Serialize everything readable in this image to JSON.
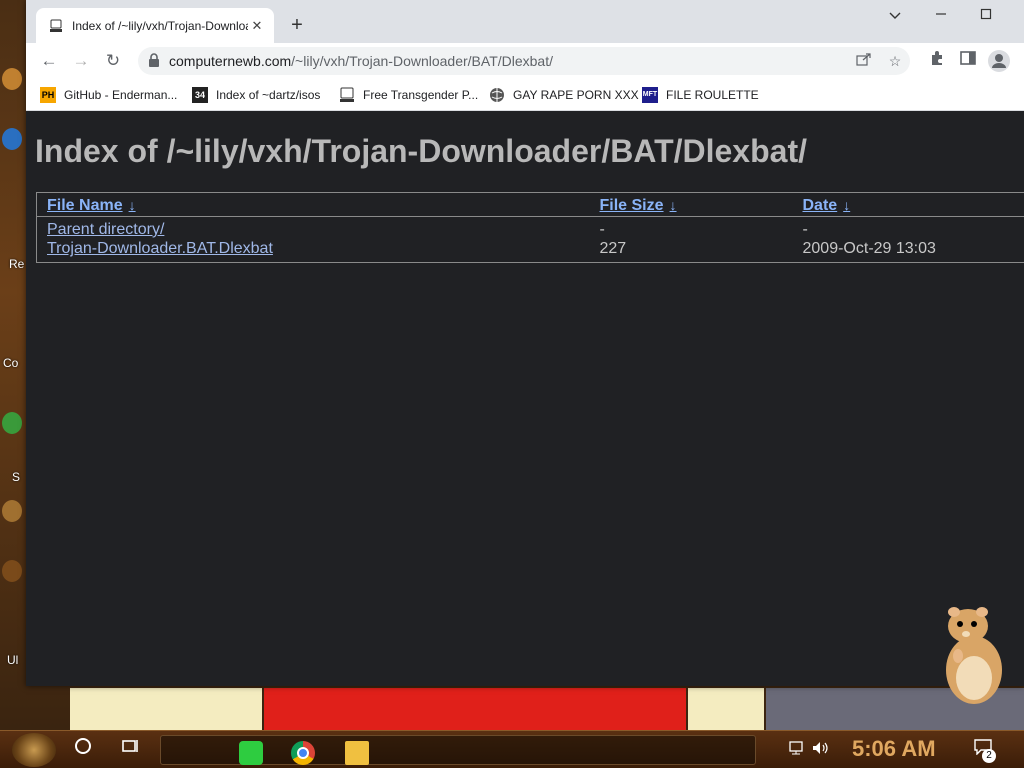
{
  "desktop": {
    "labels": [
      "Re",
      "Co",
      "S",
      "Ul"
    ]
  },
  "browser": {
    "tab": {
      "title": "Index of /~lily/vxh/Trojan-Downloader/BAT/Dlexbat/",
      "close": "✕"
    },
    "new_tab": "+",
    "window_controls": {
      "minimize": "⌄",
      "restore": "—",
      "maximize": "☐"
    },
    "nav": {
      "back": "←",
      "forward": "→",
      "reload": "↻"
    },
    "url": {
      "host": "computernewb.com",
      "path": "/~lily/vxh/Trojan-Downloader/BAT/Dlexbat/"
    },
    "bookmarks": [
      {
        "label": "GitHub - Enderman...",
        "icon": "PH",
        "icon_bg": "#f7a600",
        "icon_fg": "#000000"
      },
      {
        "label": "Index of ~dartz/isos",
        "icon": "34",
        "icon_bg": "#222222",
        "icon_fg": "#ffffff"
      },
      {
        "label": "Free Transgender P...",
        "icon": "monitor-icon",
        "icon_bg": "#ffffff",
        "icon_fg": "#333333"
      },
      {
        "label": "GAY RAPE PORN XXX",
        "icon": "globe-icon",
        "icon_bg": "#ffffff",
        "icon_fg": "#555555"
      },
      {
        "label": "FILE ROULETTE",
        "icon": "MFT",
        "icon_bg": "#1e1e8c",
        "icon_fg": "#ffffff"
      }
    ]
  },
  "page": {
    "title": "Index of /~lily/vxh/Trojan-Downloader/BAT/Dlexbat/",
    "columns": {
      "name": "File Name",
      "size": "File Size",
      "date": "Date",
      "sort_arrow": "↓"
    },
    "rows": [
      {
        "name": "Parent directory/",
        "size": "-",
        "date": "-"
      },
      {
        "name": "Trojan-Downloader.BAT.Dlexbat",
        "size": "227",
        "date": "2009-Oct-29 13:03"
      }
    ]
  },
  "taskbar": {
    "clock": "5:06 AM",
    "notification_count": "2"
  },
  "colors": {
    "page_bg": "#202124",
    "link": "#8ab4f8",
    "title": "#b8b8b8",
    "clock": "#e0a860"
  }
}
